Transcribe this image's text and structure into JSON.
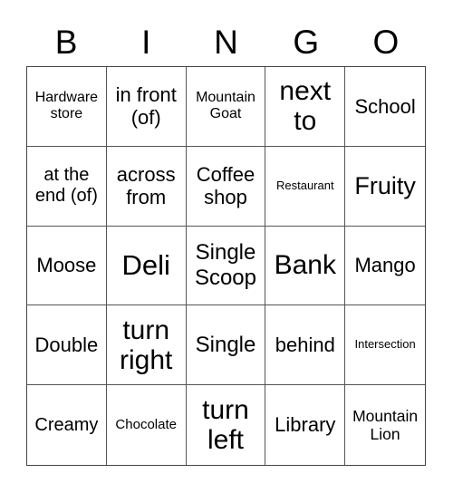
{
  "header": {
    "letters": [
      "B",
      "I",
      "N",
      "G",
      "O"
    ]
  },
  "cells": [
    [
      "Hardware store",
      "in front (of)",
      "Mountain Goat",
      "next to",
      "School"
    ],
    [
      "at the end (of)",
      "across from",
      "Coffee shop",
      "Restaurant",
      "Fruity"
    ],
    [
      "Moose",
      "Deli",
      "Single Scoop",
      "Bank",
      "Mango"
    ],
    [
      "Double",
      "turn right",
      "Single",
      "behind",
      "Intersection"
    ],
    [
      "Creamy",
      "Chocolate",
      "turn left",
      "Library",
      "Mountain Lion"
    ]
  ]
}
